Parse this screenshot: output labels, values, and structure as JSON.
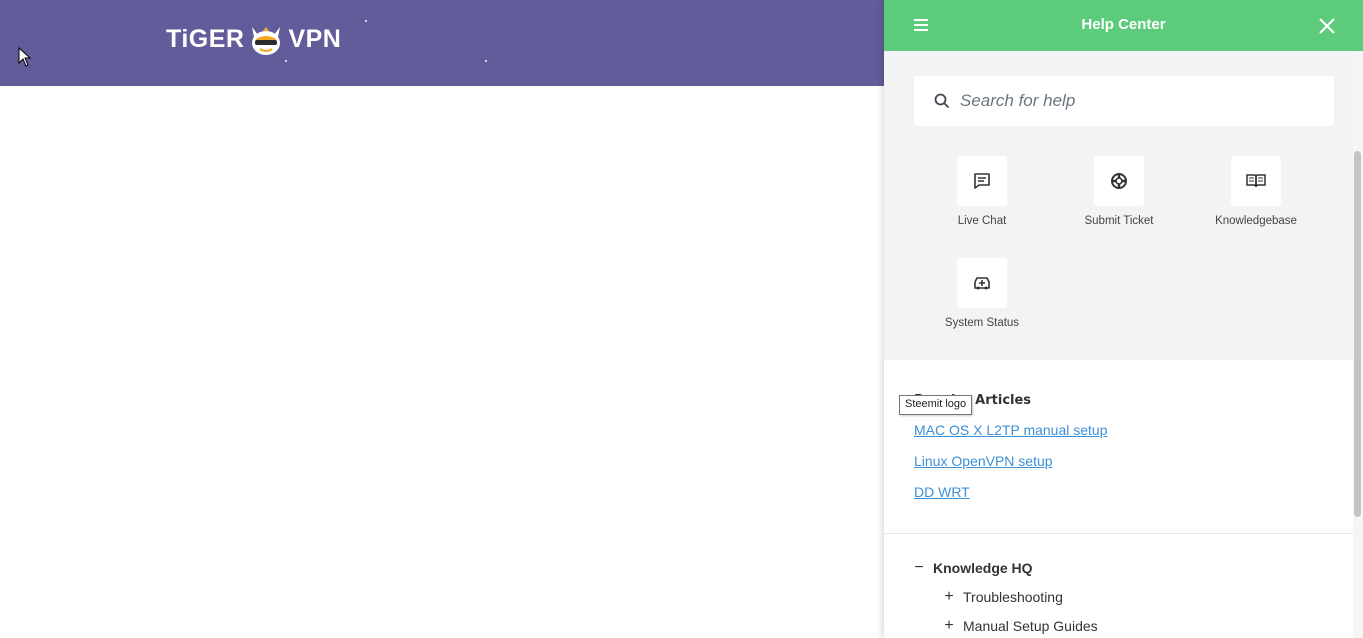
{
  "site": {
    "logo_text_left": "TiGER",
    "logo_text_right": "VPN",
    "header_color": "#635c9a"
  },
  "help_center": {
    "title": "Help Center",
    "accent_color": "#5ccb7b",
    "search": {
      "placeholder": "Search for help",
      "value": ""
    },
    "actions": [
      {
        "label": "Live Chat",
        "icon": "chat-icon"
      },
      {
        "label": "Submit Ticket",
        "icon": "lifebuoy-icon"
      },
      {
        "label": "Knowledgebase",
        "icon": "book-icon"
      },
      {
        "label": "System Status",
        "icon": "status-icon"
      }
    ],
    "articles_heading": "Popular Articles",
    "tooltip": "Steemit logo",
    "articles": [
      {
        "title": "MAC OS X L2TP manual setup"
      },
      {
        "title": "Linux OpenVPN setup"
      },
      {
        "title": "DD WRT"
      }
    ],
    "tree": {
      "root": {
        "label": "Knowledge HQ",
        "symbol": "−"
      },
      "children": [
        {
          "label": "Troubleshooting",
          "symbol": "+"
        },
        {
          "label": "Manual Setup Guides",
          "symbol": "+"
        }
      ]
    },
    "link_color": "#3d8fd6"
  }
}
